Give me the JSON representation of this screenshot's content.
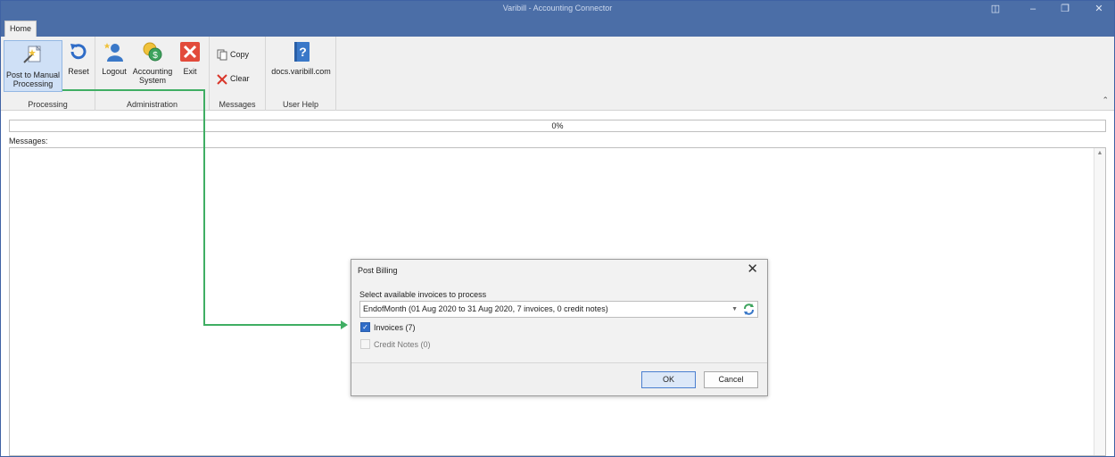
{
  "window": {
    "title": "Varibill - Accounting Connector"
  },
  "tabs": {
    "home": "Home"
  },
  "ribbon": {
    "processing": {
      "label": "Processing",
      "post_manual": "Post to Manual Processing",
      "reset": "Reset"
    },
    "administration": {
      "label": "Administration",
      "logout": "Logout",
      "accounting_system": "Accounting System",
      "exit": "Exit"
    },
    "messages": {
      "label": "Messages",
      "copy": "Copy",
      "clear": "Clear"
    },
    "user_help": {
      "label": "User Help",
      "docs": "docs.varibill.com"
    }
  },
  "progress": {
    "text": "0%",
    "value": 0
  },
  "messages": {
    "label": "Messages:"
  },
  "dialog": {
    "title": "Post Billing",
    "prompt": "Select available invoices to process",
    "selected": "EndofMonth (01 Aug 2020 to 31 Aug 2020, 7 invoices, 0 credit notes)",
    "invoices_label": "Invoices (7)",
    "invoices_checked": true,
    "credit_notes_label": "Credit Notes (0)",
    "credit_notes_checked": false,
    "ok": "OK",
    "cancel": "Cancel"
  },
  "colors": {
    "titlebar": "#4b6ea7",
    "ribbon": "#f0f0f0",
    "accent": "#2f6cc7",
    "connector": "#3fae63"
  }
}
